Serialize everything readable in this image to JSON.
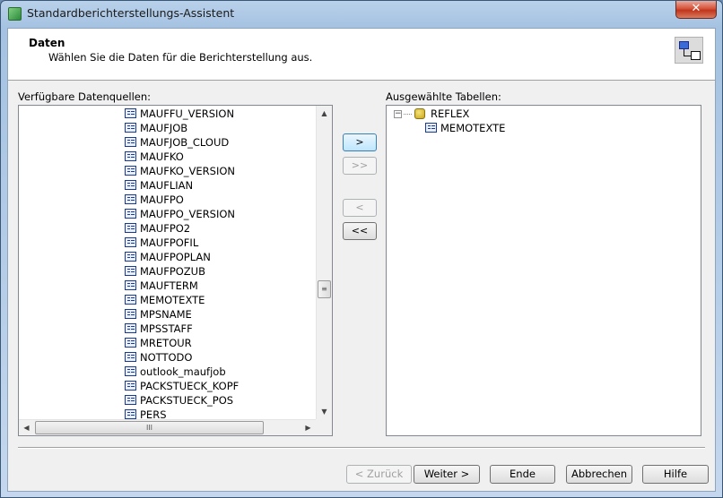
{
  "window": {
    "title": "Standardberichterstellungs-Assistent",
    "close_glyph": "✕"
  },
  "header": {
    "title": "Daten",
    "subtitle": "Wählen Sie die Daten für die Berichterstellung aus."
  },
  "left_panel": {
    "label": "Verfügbare Datenquellen:",
    "items": [
      "MAUFFU_VERSION",
      "MAUFJOB",
      "MAUFJOB_CLOUD",
      "MAUFKO",
      "MAUFKO_VERSION",
      "MAUFLIAN",
      "MAUFPO",
      "MAUFPO_VERSION",
      "MAUFPO2",
      "MAUFPOFIL",
      "MAUFPOPLAN",
      "MAUFPOZUB",
      "MAUFTERM",
      "MEMOTEXTE",
      "MPSNAME",
      "MPSSTAFF",
      "MRETOUR",
      "NOTTODO",
      "outlook_maufjob",
      "PACKSTUECK_KOPF",
      "PACKSTUECK_POS",
      "PERS"
    ]
  },
  "right_panel": {
    "label": "Ausgewählte Tabellen:",
    "root": "REFLEX",
    "children": [
      "MEMOTEXTE"
    ]
  },
  "move_buttons": {
    "add": ">",
    "add_all": ">>",
    "remove": "<",
    "remove_all": "<<"
  },
  "scroll_glyphs": {
    "up": "▲",
    "down": "▼",
    "left": "◀",
    "right": "▶",
    "grip_v": "≡",
    "grip_h": "III"
  },
  "footer": {
    "back": "< Zurück",
    "next": "Weiter >",
    "finish": "Ende",
    "cancel": "Abbrechen",
    "help": "Hilfe"
  },
  "colors": {
    "titlebar": "#a5c2e2",
    "close": "#c0351c",
    "accent": "#3c7fb1"
  }
}
